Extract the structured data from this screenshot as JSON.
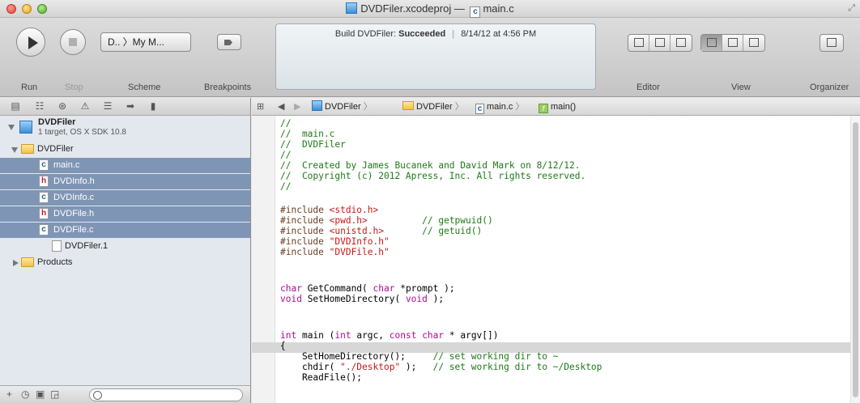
{
  "window": {
    "project": "DVDFiler.xcodeproj",
    "dash": "—",
    "file": "main.c",
    "c_glyph": "c"
  },
  "toolbar": {
    "run_label": "Run",
    "stop_label": "Stop",
    "scheme_label": "Scheme",
    "scheme_text": "D.. 〉My M...",
    "breakpoints_label": "Breakpoints",
    "editor_label": "Editor",
    "view_label": "View",
    "organizer_label": "Organizer"
  },
  "activity": {
    "build_prefix": "Build DVDFiler:",
    "build_status": "Succeeded",
    "separator": "|",
    "timestamp": "8/14/12 at 4:56 PM"
  },
  "navigator": {
    "project_name": "DVDFiler",
    "project_sub": "1 target, OS X SDK 10.8",
    "group_name": "DVDFiler",
    "files": [
      {
        "name": "main.c",
        "type": "c"
      },
      {
        "name": "DVDInfo.h",
        "type": "h"
      },
      {
        "name": "DVDInfo.c",
        "type": "c"
      },
      {
        "name": "DVDFile.h",
        "type": "h"
      },
      {
        "name": "DVDFile.c",
        "type": "c"
      },
      {
        "name": "DVDFiler.1",
        "type": "doc"
      }
    ],
    "products_name": "Products",
    "footer_plus": "+"
  },
  "jumpbar": {
    "project": "DVDFiler",
    "group": "DVDFiler",
    "file": "main.c",
    "function": "main()"
  },
  "code": {
    "lines": [
      "//",
      "//  main.c",
      "//  DVDFiler",
      "//",
      "//  Created by James Bucanek and David Mark on 8/12/12.",
      "//  Copyright (c) 2012 Apress, Inc. All rights reserved.",
      "//",
      "",
      "#include <stdio.h>",
      "#include <pwd.h>          // getpwuid()",
      "#include <unistd.h>       // getuid()",
      "#include \"DVDInfo.h\"",
      "#include \"DVDFile.h\"",
      "",
      "",
      "char GetCommand( char *prompt );",
      "void SetHomeDirectory( void );",
      "",
      "",
      "int main (int argc, const char * argv[])",
      "{",
      "    SetHomeDirectory();     // set working dir to ~",
      "    chdir( \"./Desktop\" );   // set working dir to ~/Desktop",
      "    ReadFile();"
    ]
  }
}
